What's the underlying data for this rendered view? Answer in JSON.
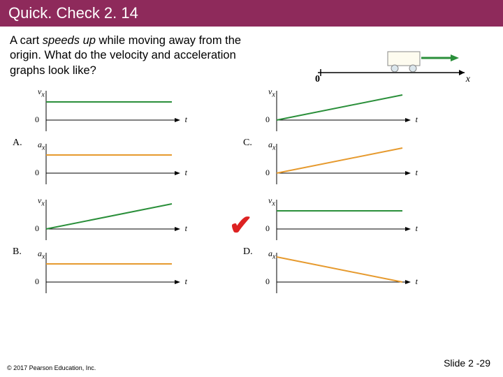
{
  "title": "Quick. Check 2. 14",
  "question_prefix": "A cart ",
  "question_emph": "speeds up",
  "question_suffix": " while moving away from the origin. What do the velocity and acceleration graphs look like?",
  "cart": {
    "zero": "0",
    "axis": "x"
  },
  "axis": {
    "vx": "v",
    "ax": "a",
    "sub": "x",
    "zero": "0",
    "t": "t"
  },
  "labels": {
    "A": "A.",
    "B": "B.",
    "C": "C.",
    "D": "D."
  },
  "check": "✔",
  "copyright": "© 2017 Pearson Education, Inc.",
  "slide": "Slide 2 -29",
  "chart_data": [
    {
      "id": "A",
      "velocity": {
        "type": "line",
        "shape": "flat_positive",
        "x": [
          0,
          1
        ],
        "y": [
          1,
          1
        ],
        "xlim": [
          0,
          1
        ],
        "ylim": [
          -0.5,
          1.5
        ],
        "xlabel": "t",
        "ylabel": "v_x"
      },
      "acceleration": {
        "type": "line",
        "shape": "flat_positive",
        "x": [
          0,
          1
        ],
        "y": [
          1,
          1
        ],
        "xlim": [
          0,
          1
        ],
        "ylim": [
          -0.5,
          1.5
        ],
        "xlabel": "t",
        "ylabel": "a_x"
      }
    },
    {
      "id": "B",
      "correct": true,
      "velocity": {
        "type": "line",
        "shape": "increasing_from_zero",
        "x": [
          0,
          1
        ],
        "y": [
          0,
          1
        ],
        "xlim": [
          0,
          1
        ],
        "ylim": [
          -0.5,
          1.5
        ],
        "xlabel": "t",
        "ylabel": "v_x"
      },
      "acceleration": {
        "type": "line",
        "shape": "flat_positive",
        "x": [
          0,
          1
        ],
        "y": [
          1,
          1
        ],
        "xlim": [
          0,
          1
        ],
        "ylim": [
          -0.5,
          1.5
        ],
        "xlabel": "t",
        "ylabel": "a_x"
      }
    },
    {
      "id": "C",
      "velocity": {
        "type": "line",
        "shape": "increasing_from_zero",
        "x": [
          0,
          1
        ],
        "y": [
          0,
          1
        ],
        "xlim": [
          0,
          1
        ],
        "ylim": [
          -0.5,
          1.5
        ],
        "xlabel": "t",
        "ylabel": "v_x"
      },
      "acceleration": {
        "type": "line",
        "shape": "increasing_from_zero",
        "x": [
          0,
          1
        ],
        "y": [
          0,
          1
        ],
        "xlim": [
          0,
          1
        ],
        "ylim": [
          -0.5,
          1.5
        ],
        "xlabel": "t",
        "ylabel": "a_x"
      }
    },
    {
      "id": "D",
      "velocity": {
        "type": "line",
        "shape": "flat_positive",
        "x": [
          0,
          1
        ],
        "y": [
          1,
          1
        ],
        "xlim": [
          0,
          1
        ],
        "ylim": [
          -0.5,
          1.5
        ],
        "xlabel": "t",
        "ylabel": "v_x"
      },
      "acceleration": {
        "type": "line",
        "shape": "decreasing_from_positive_to_zero",
        "x": [
          0,
          1
        ],
        "y": [
          1,
          0
        ],
        "xlim": [
          0,
          1
        ],
        "ylim": [
          -0.5,
          1.5
        ],
        "xlabel": "t",
        "ylabel": "a_x"
      }
    }
  ]
}
